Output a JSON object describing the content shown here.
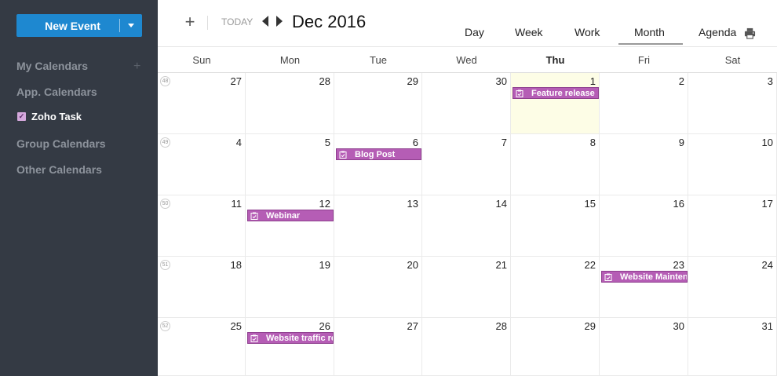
{
  "sidebar": {
    "new_event_label": "New Event",
    "sections": [
      "My Calendars",
      "App. Calendars",
      "Group Calendars",
      "Other Calendars"
    ],
    "app_calendar_item": "Zoho Task"
  },
  "header": {
    "today_label": "TODAY",
    "month_title": "Dec 2016",
    "views": [
      "Day",
      "Week",
      "Work",
      "Month",
      "Agenda"
    ],
    "active_view": "Month"
  },
  "calendar": {
    "weekdays": [
      "Sun",
      "Mon",
      "Tue",
      "Wed",
      "Thu",
      "Fri",
      "Sat"
    ],
    "highlight_weekday": "Thu",
    "weeks": [
      {
        "num": "48",
        "days": [
          "27",
          "28",
          "29",
          "30",
          "1",
          "2",
          "3"
        ]
      },
      {
        "num": "49",
        "days": [
          "4",
          "5",
          "6",
          "7",
          "8",
          "9",
          "10"
        ]
      },
      {
        "num": "50",
        "days": [
          "11",
          "12",
          "13",
          "14",
          "15",
          "16",
          "17"
        ]
      },
      {
        "num": "51",
        "days": [
          "18",
          "19",
          "20",
          "21",
          "22",
          "23",
          "24"
        ]
      },
      {
        "num": "52",
        "days": [
          "25",
          "26",
          "27",
          "28",
          "29",
          "30",
          "31"
        ]
      }
    ],
    "today": {
      "week": 0,
      "day": 4
    },
    "events": [
      {
        "title": "Feature release",
        "week": 0,
        "day": 4
      },
      {
        "title": "Blog Post",
        "week": 1,
        "day": 2
      },
      {
        "title": "Webinar",
        "week": 2,
        "day": 1
      },
      {
        "title": "Website Mainten",
        "week": 3,
        "day": 5
      },
      {
        "title": "Website traffic re",
        "week": 4,
        "day": 1
      }
    ],
    "event_icon": "task-clipboard-icon"
  },
  "colors": {
    "sidebar_bg": "#343a44",
    "accent": "#1e88d0",
    "event": "#b55db5",
    "today_bg": "#fdfde6"
  }
}
